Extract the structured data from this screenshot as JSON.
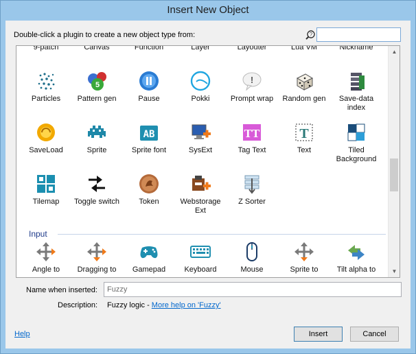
{
  "window": {
    "title": "Insert New Object"
  },
  "instruction": "Double-click a plugin to create a new object type from:",
  "search": {
    "value": "",
    "placeholder": ""
  },
  "top_row_cut": [
    "9-patch",
    "Canvas",
    "Function",
    "Layer",
    "Layouter",
    "Lua VM",
    "Nickname"
  ],
  "rows": [
    [
      {
        "label": "Particles",
        "icon": "particles-icon"
      },
      {
        "label": "Pattern gen",
        "icon": "pattern-gen-icon"
      },
      {
        "label": "Pause",
        "icon": "pause-icon"
      },
      {
        "label": "Pokki",
        "icon": "pokki-icon"
      },
      {
        "label": "Prompt wrap",
        "icon": "prompt-wrap-icon"
      },
      {
        "label": "Random gen",
        "icon": "random-gen-icon"
      },
      {
        "label": "Save-data index",
        "icon": "save-data-index-icon"
      }
    ],
    [
      {
        "label": "SaveLoad",
        "icon": "saveload-icon"
      },
      {
        "label": "Sprite",
        "icon": "sprite-icon"
      },
      {
        "label": "Sprite font",
        "icon": "sprite-font-icon"
      },
      {
        "label": "SysExt",
        "icon": "sysext-icon"
      },
      {
        "label": "Tag Text",
        "icon": "tag-text-icon"
      },
      {
        "label": "Text",
        "icon": "text-icon"
      },
      {
        "label": "Tiled Background",
        "icon": "tiled-background-icon"
      }
    ],
    [
      {
        "label": "Tilemap",
        "icon": "tilemap-icon"
      },
      {
        "label": "Toggle switch",
        "icon": "toggle-switch-icon"
      },
      {
        "label": "Token",
        "icon": "token-icon"
      },
      {
        "label": "Webstorage Ext",
        "icon": "webstorage-ext-icon"
      },
      {
        "label": "Z Sorter",
        "icon": "z-sorter-icon"
      }
    ]
  ],
  "input_group": {
    "title": "Input",
    "items": [
      {
        "label": "Angle to",
        "icon": "angle-to-icon"
      },
      {
        "label": "Dragging to",
        "icon": "dragging-to-icon"
      },
      {
        "label": "Gamepad",
        "icon": "gamepad-icon"
      },
      {
        "label": "Keyboard",
        "icon": "keyboard-icon"
      },
      {
        "label": "Mouse",
        "icon": "mouse-icon"
      },
      {
        "label": "Sprite to",
        "icon": "sprite-to-icon"
      },
      {
        "label": "Tilt alpha to",
        "icon": "tilt-alpha-to-icon"
      }
    ]
  },
  "name_when_inserted": {
    "label": "Name when inserted:",
    "value": "Fuzzy"
  },
  "description": {
    "label": "Description:",
    "text": "Fuzzy logic - ",
    "link": "More help on 'Fuzzy'"
  },
  "buttons": {
    "help": "Help",
    "insert": "Insert",
    "cancel": "Cancel"
  }
}
